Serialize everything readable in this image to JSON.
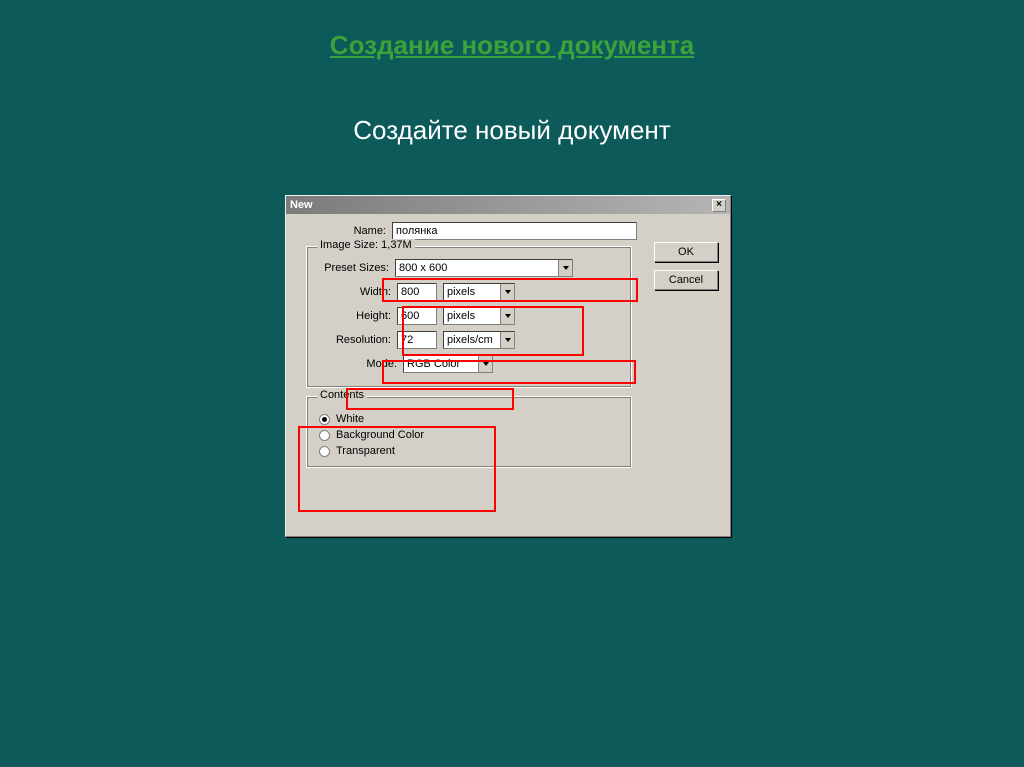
{
  "slide": {
    "title": "Создание нового документа",
    "subtitle": "Создайте новый документ"
  },
  "dialog": {
    "title": "New",
    "name_label": "Name:",
    "name_value": "полянка",
    "image_size_legend": "Image Size: 1,37M",
    "preset_label": "Preset Sizes:",
    "preset_value": "800 x 600",
    "width_label": "Width:",
    "width_value": "800",
    "width_unit": "pixels",
    "height_label": "Height:",
    "height_value": "600",
    "height_unit": "pixels",
    "resolution_label": "Resolution:",
    "resolution_value": "72",
    "resolution_unit": "pixels/cm",
    "mode_label": "Mode:",
    "mode_value": "RGB Color",
    "contents_legend": "Contents",
    "contents_white": "White",
    "contents_bg": "Background Color",
    "contents_trans": "Transparent",
    "ok": "OK",
    "cancel": "Cancel",
    "close": "×"
  }
}
